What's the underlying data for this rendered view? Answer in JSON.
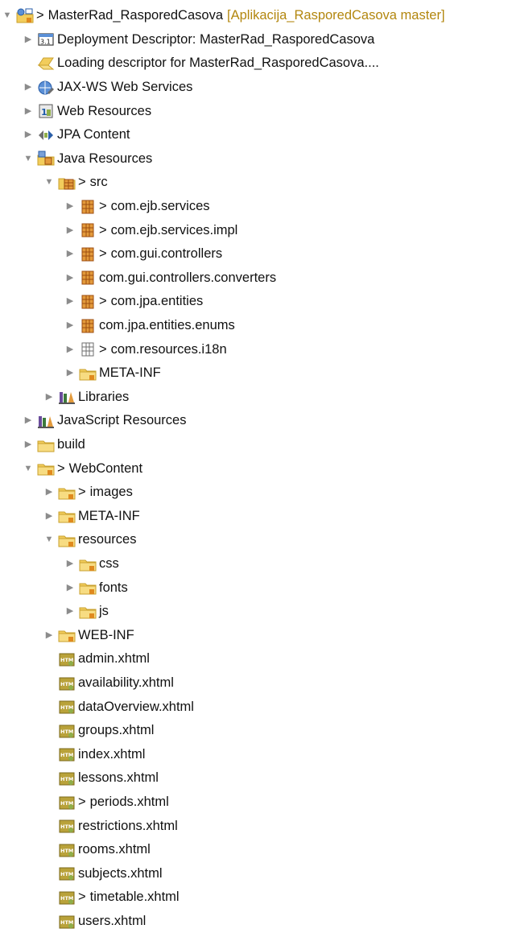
{
  "tree": {
    "rows": [
      {
        "depth": 0,
        "expander": "expanded",
        "icon": "project-icon",
        "dirty": true,
        "label": "MasterRad_RasporedCasova",
        "decoration": "[Aplikacija_RasporedCasova master]"
      },
      {
        "depth": 1,
        "expander": "collapsed",
        "icon": "deployment-descriptor-icon",
        "dirty": false,
        "label": "Deployment Descriptor: MasterRad_RasporedCasova"
      },
      {
        "depth": 1,
        "expander": "none",
        "icon": "loading-icon",
        "dirty": false,
        "label": "Loading descriptor for MasterRad_RasporedCasova...."
      },
      {
        "depth": 1,
        "expander": "collapsed",
        "icon": "web-services-icon",
        "dirty": false,
        "label": "JAX-WS Web Services"
      },
      {
        "depth": 1,
        "expander": "collapsed",
        "icon": "web-resources-icon",
        "dirty": false,
        "label": "Web Resources"
      },
      {
        "depth": 1,
        "expander": "collapsed",
        "icon": "jpa-content-icon",
        "dirty": false,
        "label": "JPA Content"
      },
      {
        "depth": 1,
        "expander": "expanded",
        "icon": "java-resources-icon",
        "dirty": false,
        "label": "Java Resources"
      },
      {
        "depth": 2,
        "expander": "expanded",
        "icon": "source-folder-icon",
        "dirty": true,
        "label": "src"
      },
      {
        "depth": 3,
        "expander": "collapsed",
        "icon": "package-icon",
        "dirty": true,
        "label": "com.ejb.services"
      },
      {
        "depth": 3,
        "expander": "collapsed",
        "icon": "package-icon",
        "dirty": true,
        "label": "com.ejb.services.impl"
      },
      {
        "depth": 3,
        "expander": "collapsed",
        "icon": "package-icon",
        "dirty": true,
        "label": "com.gui.controllers"
      },
      {
        "depth": 3,
        "expander": "collapsed",
        "icon": "package-icon",
        "dirty": false,
        "label": "com.gui.controllers.converters"
      },
      {
        "depth": 3,
        "expander": "collapsed",
        "icon": "package-icon",
        "dirty": true,
        "label": "com.jpa.entities"
      },
      {
        "depth": 3,
        "expander": "collapsed",
        "icon": "package-icon",
        "dirty": false,
        "label": "com.jpa.entities.enums"
      },
      {
        "depth": 3,
        "expander": "collapsed",
        "icon": "empty-package-icon",
        "dirty": true,
        "label": "com.resources.i18n"
      },
      {
        "depth": 3,
        "expander": "collapsed",
        "icon": "folder-icon",
        "dirty": false,
        "label": "META-INF"
      },
      {
        "depth": 2,
        "expander": "collapsed",
        "icon": "libraries-icon",
        "dirty": false,
        "label": "Libraries"
      },
      {
        "depth": 1,
        "expander": "collapsed",
        "icon": "libraries-icon",
        "dirty": false,
        "label": "JavaScript Resources"
      },
      {
        "depth": 1,
        "expander": "collapsed",
        "icon": "plain-folder-icon",
        "dirty": false,
        "label": "build"
      },
      {
        "depth": 1,
        "expander": "expanded",
        "icon": "folder-icon",
        "dirty": true,
        "label": "WebContent"
      },
      {
        "depth": 2,
        "expander": "collapsed",
        "icon": "folder-icon",
        "dirty": true,
        "label": "images"
      },
      {
        "depth": 2,
        "expander": "collapsed",
        "icon": "folder-icon",
        "dirty": false,
        "label": "META-INF"
      },
      {
        "depth": 2,
        "expander": "expanded",
        "icon": "folder-icon",
        "dirty": false,
        "label": "resources"
      },
      {
        "depth": 3,
        "expander": "collapsed",
        "icon": "folder-icon",
        "dirty": false,
        "label": "css"
      },
      {
        "depth": 3,
        "expander": "collapsed",
        "icon": "folder-icon",
        "dirty": false,
        "label": "fonts"
      },
      {
        "depth": 3,
        "expander": "collapsed",
        "icon": "folder-icon",
        "dirty": false,
        "label": "js"
      },
      {
        "depth": 2,
        "expander": "collapsed",
        "icon": "folder-icon",
        "dirty": false,
        "label": "WEB-INF"
      },
      {
        "depth": 2,
        "expander": "none",
        "icon": "xhtml-file-icon",
        "dirty": false,
        "label": "admin.xhtml"
      },
      {
        "depth": 2,
        "expander": "none",
        "icon": "xhtml-file-icon",
        "dirty": false,
        "label": "availability.xhtml"
      },
      {
        "depth": 2,
        "expander": "none",
        "icon": "xhtml-file-icon",
        "dirty": false,
        "label": "dataOverview.xhtml"
      },
      {
        "depth": 2,
        "expander": "none",
        "icon": "xhtml-file-icon",
        "dirty": false,
        "label": "groups.xhtml"
      },
      {
        "depth": 2,
        "expander": "none",
        "icon": "xhtml-file-icon",
        "dirty": false,
        "label": "index.xhtml"
      },
      {
        "depth": 2,
        "expander": "none",
        "icon": "xhtml-file-icon",
        "dirty": false,
        "label": "lessons.xhtml"
      },
      {
        "depth": 2,
        "expander": "none",
        "icon": "xhtml-file-icon",
        "dirty": true,
        "label": "periods.xhtml"
      },
      {
        "depth": 2,
        "expander": "none",
        "icon": "xhtml-file-icon",
        "dirty": false,
        "label": "restrictions.xhtml"
      },
      {
        "depth": 2,
        "expander": "none",
        "icon": "xhtml-file-icon",
        "dirty": false,
        "label": "rooms.xhtml"
      },
      {
        "depth": 2,
        "expander": "none",
        "icon": "xhtml-file-icon",
        "dirty": false,
        "label": "subjects.xhtml"
      },
      {
        "depth": 2,
        "expander": "none",
        "icon": "xhtml-file-icon",
        "dirty": true,
        "label": "timetable.xhtml"
      },
      {
        "depth": 2,
        "expander": "none",
        "icon": "xhtml-file-icon",
        "dirty": false,
        "label": "users.xhtml"
      }
    ],
    "dirty_marker": ">",
    "expanded_glyph": "▼",
    "collapsed_glyph": "▶",
    "colors": {
      "decoration": "#b3870f",
      "twisty": "#8c8c8c",
      "folder": "#f2cd5c",
      "package": "#b5651d"
    }
  }
}
